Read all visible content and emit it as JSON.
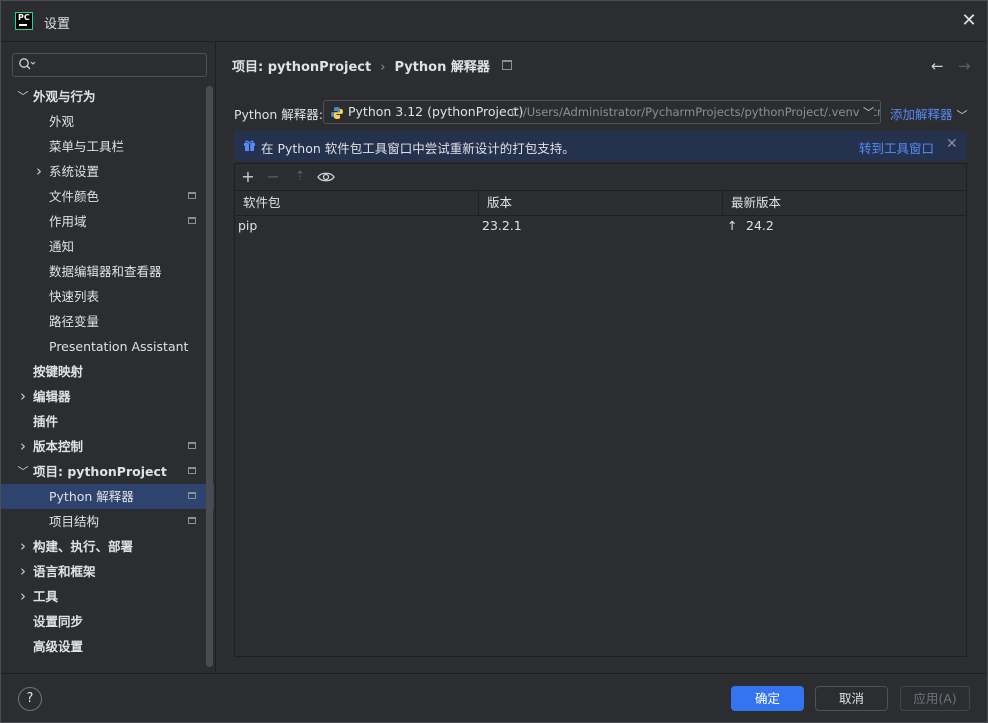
{
  "window": {
    "title": "设置",
    "close_glyph": "✕"
  },
  "sidebar": {
    "items": [
      {
        "label": "外观与行为",
        "bold": true,
        "chevron": "down",
        "level": 0
      },
      {
        "label": "外观",
        "level": 1
      },
      {
        "label": "菜单与工具栏",
        "level": 1
      },
      {
        "label": "系统设置",
        "level": 1,
        "chevron": "right"
      },
      {
        "label": "文件颜色",
        "level": 1,
        "badge": true
      },
      {
        "label": "作用域",
        "level": 1,
        "badge": true
      },
      {
        "label": "通知",
        "level": 1
      },
      {
        "label": "数据编辑器和查看器",
        "level": 1
      },
      {
        "label": "快速列表",
        "level": 1
      },
      {
        "label": "路径变量",
        "level": 1
      },
      {
        "label": "Presentation Assistant",
        "level": 1
      },
      {
        "label": "按键映射",
        "bold": true,
        "level": 0
      },
      {
        "label": "编辑器",
        "bold": true,
        "chevron": "right",
        "level": 0
      },
      {
        "label": "插件",
        "bold": true,
        "level": 0
      },
      {
        "label": "版本控制",
        "bold": true,
        "chevron": "right",
        "level": 0,
        "badge": true
      },
      {
        "label": "项目: pythonProject",
        "bold": true,
        "chevron": "down",
        "level": 0,
        "badge": true
      },
      {
        "label": "Python 解释器",
        "level": 1,
        "badge": true,
        "selected": true
      },
      {
        "label": "项目结构",
        "level": 1,
        "badge": true
      },
      {
        "label": "构建、执行、部署",
        "bold": true,
        "chevron": "right",
        "level": 0
      },
      {
        "label": "语言和框架",
        "bold": true,
        "chevron": "right",
        "level": 0
      },
      {
        "label": "工具",
        "bold": true,
        "chevron": "right",
        "level": 0
      },
      {
        "label": "设置同步",
        "bold": true,
        "level": 0
      },
      {
        "label": "高级设置",
        "bold": true,
        "level": 0
      }
    ]
  },
  "breadcrumb": {
    "project": "项目: pythonProject",
    "sep": "›",
    "page": "Python 解释器"
  },
  "nav": {
    "back": "←",
    "forward": "→"
  },
  "interpreter": {
    "label": "Python 解释器:",
    "name": "Python 3.12 (pythonProject)",
    "path": "C:/Users/Administrator/PycharmProjects/pythonProject/.venv/Scri",
    "add_label": "添加解释器",
    "add_chevron": "⌄"
  },
  "banner": {
    "text": "在 Python 软件包工具窗口中尝试重新设计的打包支持。",
    "link": "转到工具窗口",
    "close": "✕"
  },
  "table": {
    "headers": [
      "软件包",
      "版本",
      "最新版本"
    ],
    "rows": [
      {
        "package": "pip",
        "version": "23.2.1",
        "latest": "24.2",
        "upgrade_glyph": "↑"
      }
    ]
  },
  "footer": {
    "help": "?",
    "ok": "确定",
    "cancel": "取消",
    "apply": "应用(A)"
  },
  "colors": {
    "accent": "#3574f0",
    "link": "#548af7",
    "selection": "#2e436e",
    "background": "#2b2d30"
  }
}
